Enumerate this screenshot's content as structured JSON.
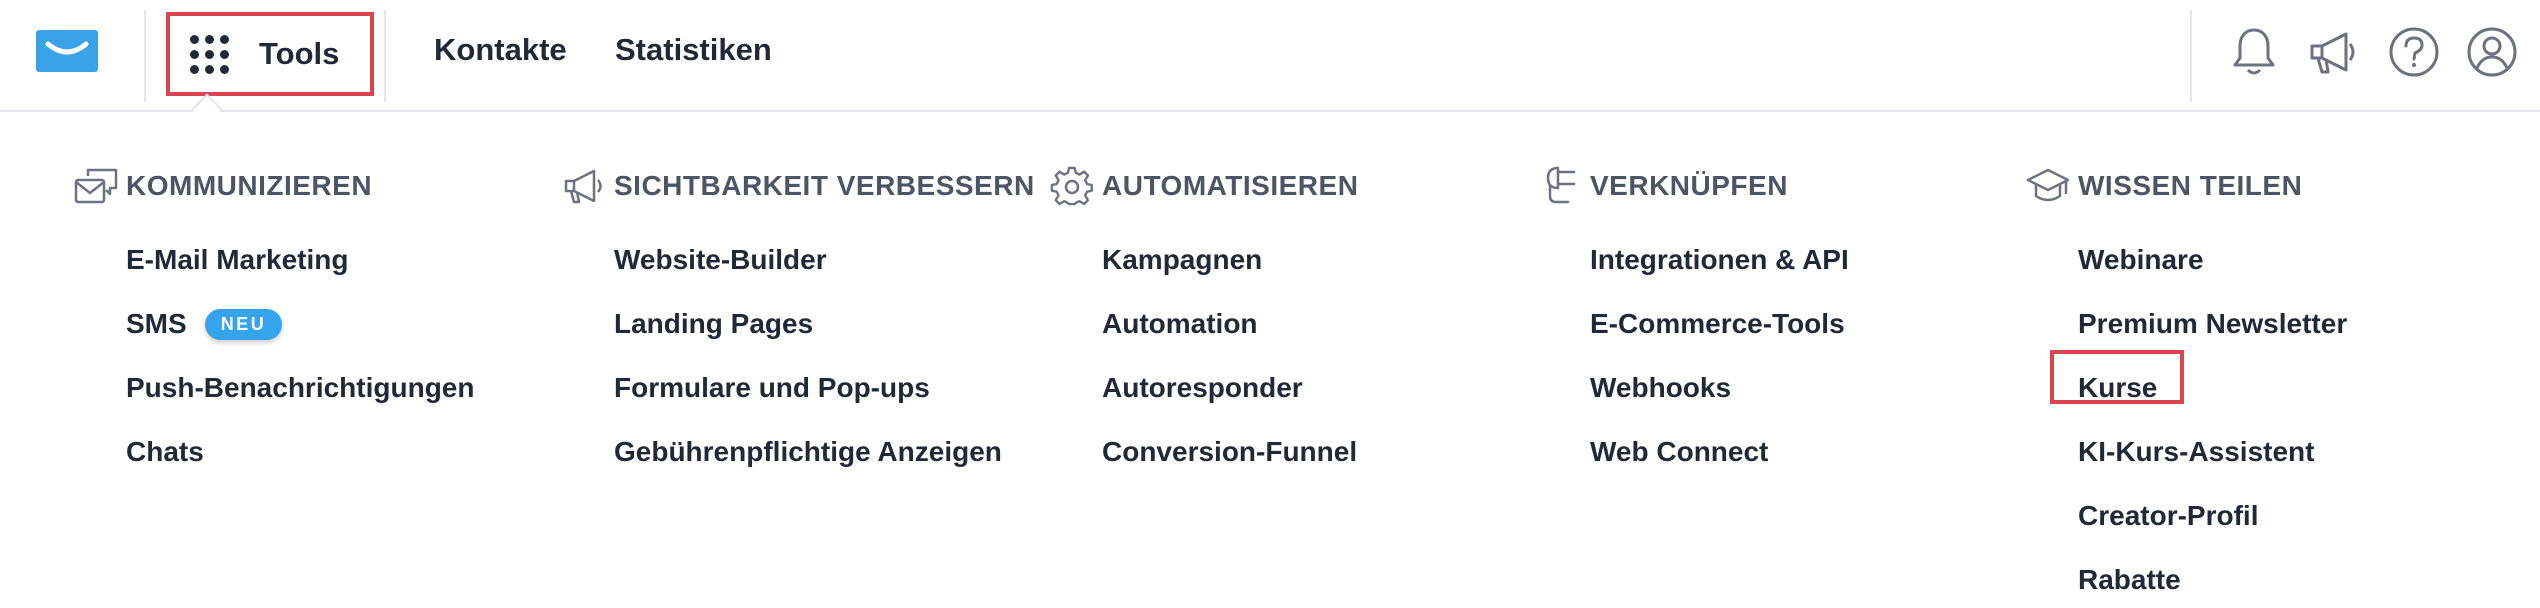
{
  "colors": {
    "accent_red": "#d9454e",
    "badge_blue": "#35a4ef",
    "logo_blue": "#3aa3e8",
    "text": "#1f2937",
    "heading": "#4b5563"
  },
  "header": {
    "tools_label": "Tools",
    "nav": [
      "Kontakte",
      "Statistiken"
    ],
    "right_icons": [
      "bell-icon",
      "megaphone-icon",
      "help-icon",
      "user-icon"
    ]
  },
  "menu": {
    "columns": [
      {
        "title": "KOMMUNIZIEREN",
        "icon": "chat-envelope-icon",
        "items": [
          "E-Mail Marketing",
          "SMS",
          "Push-Benachrichtigungen",
          "Chats"
        ],
        "badge": {
          "item": "SMS",
          "label": "NEU"
        }
      },
      {
        "title": "SICHTBARKEIT VERBESSERN",
        "icon": "megaphone-icon",
        "items": [
          "Website-Builder",
          "Landing Pages",
          "Formulare und Pop-ups",
          "Gebührenpflichtige Anzeigen"
        ]
      },
      {
        "title": "AUTOMATISIEREN",
        "icon": "gear-icon",
        "items": [
          "Kampagnen",
          "Automation",
          "Autoresponder",
          "Conversion-Funnel"
        ]
      },
      {
        "title": "VERKNÜPFEN",
        "icon": "plug-icon",
        "items": [
          "Integrationen & API",
          "E-Commerce-Tools",
          "Webhooks",
          "Web Connect"
        ]
      },
      {
        "title": "WISSEN TEILEN",
        "icon": "graduation-cap-icon",
        "items": [
          "Webinare",
          "Premium Newsletter",
          "Kurse",
          "KI-Kurs-Assistent",
          "Creator-Profil",
          "Rabatte"
        ]
      }
    ]
  }
}
